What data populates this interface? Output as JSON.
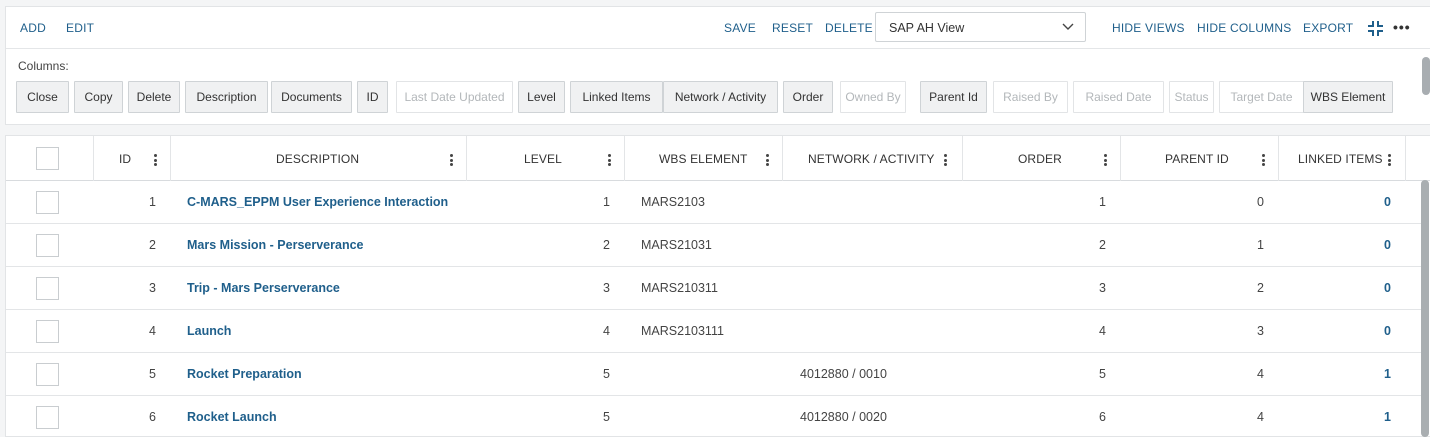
{
  "toolbar": {
    "add": "ADD",
    "edit": "EDIT",
    "save": "SAVE",
    "reset": "RESET",
    "delete": "DELETE",
    "view_select": "SAP AH View",
    "hide_views": "HIDE VIEWS",
    "hide_columns": "HIDE COLUMNS",
    "export": "EXPORT",
    "more": "•••"
  },
  "columns_panel": {
    "label": "Columns:",
    "chips": [
      {
        "label": "Close",
        "active": true
      },
      {
        "label": "Copy",
        "active": true
      },
      {
        "label": "Delete",
        "active": true
      },
      {
        "label": "Description",
        "active": true
      },
      {
        "label": "Documents",
        "active": true
      },
      {
        "label": "ID",
        "active": true
      },
      {
        "label": "Last Date Updated",
        "active": false
      },
      {
        "label": "Level",
        "active": true
      },
      {
        "label": "Linked Items",
        "active": true
      },
      {
        "label": "Network / Activity",
        "active": true
      },
      {
        "label": "Order",
        "active": true
      },
      {
        "label": "Owned By",
        "active": false
      },
      {
        "label": "Parent Id",
        "active": true
      },
      {
        "label": "Raised By",
        "active": false
      },
      {
        "label": "Raised Date",
        "active": false
      },
      {
        "label": "Status",
        "active": false
      },
      {
        "label": "Target Date",
        "active": false
      },
      {
        "label": "WBS Element",
        "active": true
      }
    ]
  },
  "table": {
    "headers": {
      "id": "ID",
      "description": "DESCRIPTION",
      "level": "LEVEL",
      "wbs": "WBS ELEMENT",
      "network": "NETWORK / ACTIVITY",
      "order": "ORDER",
      "parent": "PARENT ID",
      "linked": "LINKED ITEMS"
    },
    "rows": [
      {
        "id": "1",
        "description": "C-MARS_EPPM User Experience Interaction",
        "level": "1",
        "wbs": "MARS2103",
        "network": "",
        "order": "1",
        "parent": "0",
        "linked": "0"
      },
      {
        "id": "2",
        "description": "Mars Mission - Perserverance",
        "level": "2",
        "wbs": "MARS21031",
        "network": "",
        "order": "2",
        "parent": "1",
        "linked": "0"
      },
      {
        "id": "3",
        "description": "Trip - Mars Perserverance",
        "level": "3",
        "wbs": "MARS210311",
        "network": "",
        "order": "3",
        "parent": "2",
        "linked": "0"
      },
      {
        "id": "4",
        "description": "Launch",
        "level": "4",
        "wbs": "MARS2103111",
        "network": "",
        "order": "4",
        "parent": "3",
        "linked": "0"
      },
      {
        "id": "5",
        "description": "Rocket Preparation",
        "level": "5",
        "wbs": "",
        "network": "4012880 / 0010",
        "order": "5",
        "parent": "4",
        "linked": "1"
      },
      {
        "id": "6",
        "description": "Rocket Launch",
        "level": "5",
        "wbs": "",
        "network": "4012880 / 0020",
        "order": "6",
        "parent": "4",
        "linked": "1"
      }
    ]
  },
  "colors": {
    "link": "#1f5f8b",
    "chip_active_bg": "#f0f1f2",
    "chip_inactive_text": "#b3b7ba"
  }
}
